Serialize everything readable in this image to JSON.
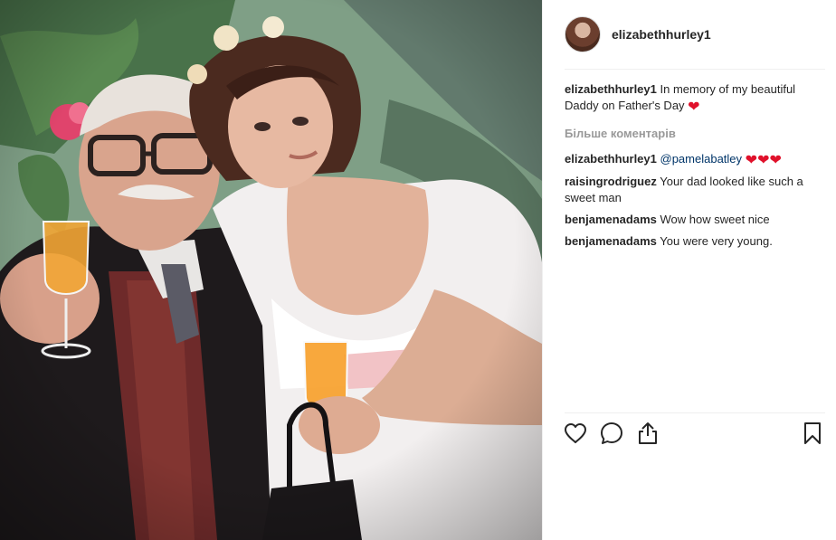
{
  "post": {
    "photo_alt": "",
    "author": "elizabethhurley1"
  },
  "caption": {
    "author": "elizabethhurley1",
    "text": "In memory of my beautiful Daddy on Father's Day",
    "emoji": "❤"
  },
  "more_comments_label": "Більше коментарів",
  "comments": [
    {
      "author": "elizabethhurley1",
      "mention": "@pamelabatley",
      "text": "",
      "emoji": "❤❤❤"
    },
    {
      "author": "raisingrodriguez",
      "mention": "",
      "text": "Your dad looked like such a sweet man",
      "emoji": ""
    },
    {
      "author": "benjamenadams",
      "mention": "",
      "text": "Wow how sweet nice",
      "emoji": ""
    },
    {
      "author": "benjamenadams",
      "mention": "",
      "text": "You were very young.",
      "emoji": ""
    }
  ],
  "actions": {
    "like": "heart-icon",
    "comment": "comment-icon",
    "share": "share-icon",
    "save": "bookmark-icon"
  },
  "colors": {
    "text": "#262626",
    "muted": "#999999",
    "mention": "#003569",
    "heart": "#e0112b",
    "divider": "#efefef"
  }
}
